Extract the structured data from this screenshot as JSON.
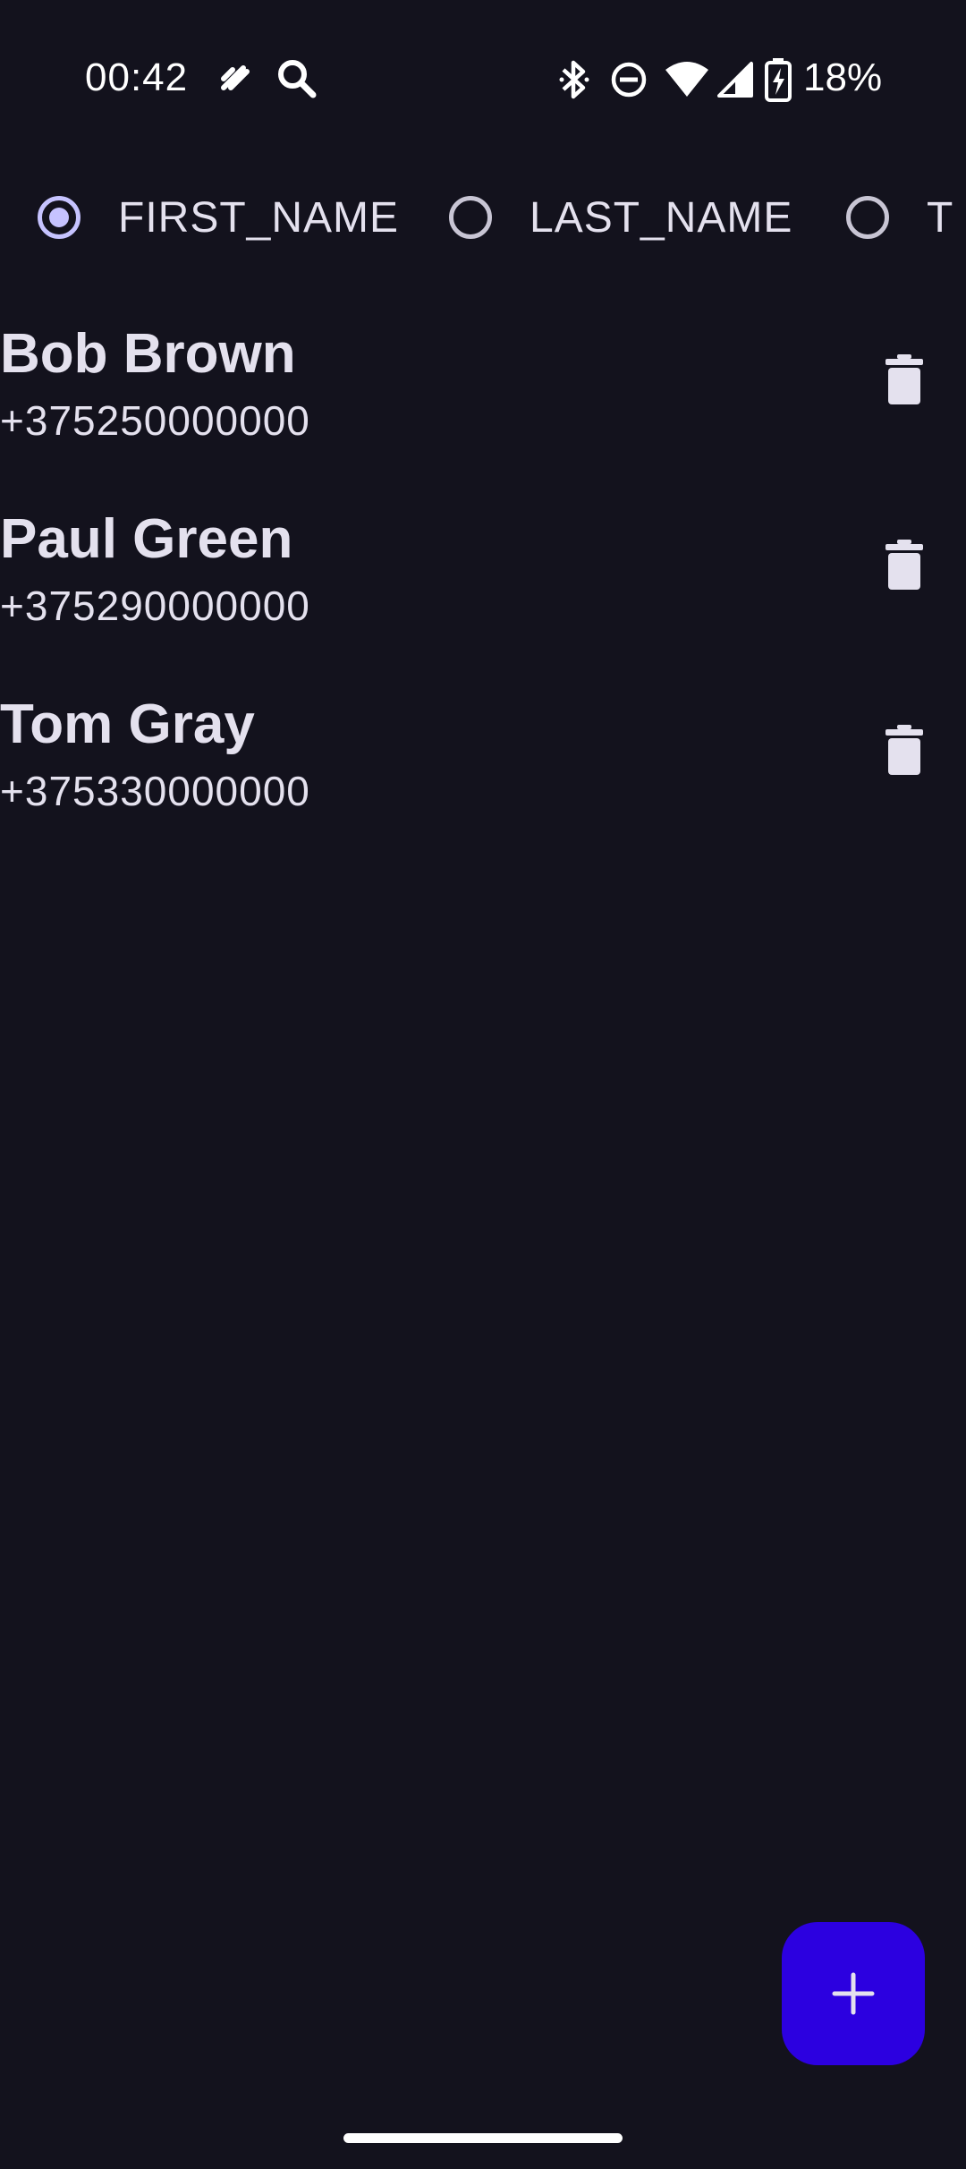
{
  "status_bar": {
    "time": "00:42",
    "battery": "18%",
    "icons": [
      "nfc-icon",
      "search-icon",
      "bluetooth-icon",
      "do-not-disturb-icon",
      "wifi-icon",
      "cell-signal-icon",
      "battery-charging-icon"
    ]
  },
  "sort_options": [
    {
      "label": "FIRST_NAME",
      "selected": true
    },
    {
      "label": "LAST_NAME",
      "selected": false
    },
    {
      "label": "T",
      "selected": false
    }
  ],
  "contacts": [
    {
      "name": "Bob Brown",
      "phone": "+375250000000"
    },
    {
      "name": "Paul Green",
      "phone": "+375290000000"
    },
    {
      "name": "Tom Gray",
      "phone": "+375330000000"
    }
  ],
  "fab": {
    "icon": "plus-icon"
  },
  "colors": {
    "background": "#13121d",
    "text": "#e4e1ee",
    "radio_selected": "#c6c3ff",
    "fab": "#2c00e0"
  }
}
